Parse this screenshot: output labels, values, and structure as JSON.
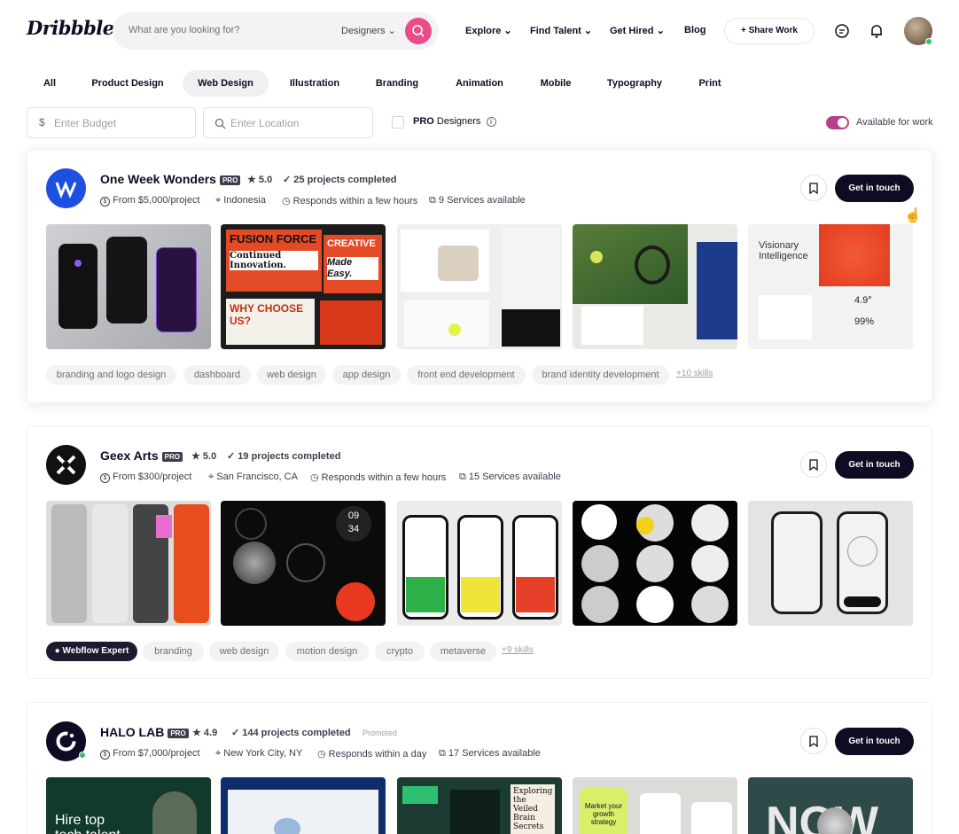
{
  "header": {
    "logo": "Dribbble",
    "search_placeholder": "What are you looking for?",
    "search_select": "Designers ⌄",
    "nav": [
      "Explore ⌄",
      "Find Talent ⌄",
      "Get Hired ⌄",
      "Blog"
    ],
    "share": "+ Share Work"
  },
  "categories": [
    "All",
    "Product Design",
    "Web Design",
    "Illustration",
    "Branding",
    "Animation",
    "Mobile",
    "Typography",
    "Print"
  ],
  "active_category": "Web Design",
  "filters": {
    "budget_placeholder": "Enter Budget",
    "location_placeholder": "Enter Location",
    "pro_label_bold": "PRO",
    "pro_label": "Designers",
    "available": "Available for work"
  },
  "colors": {
    "accent": "#ea4c89",
    "toggle": "#b53e8c",
    "dark": "#0d0c22"
  },
  "cards": [
    {
      "name": "One Week Wonders",
      "pro": "PRO",
      "rating": "★ 5.0",
      "projects": "✓ 25 projects completed",
      "price": "From $5,000/project",
      "location": "Indonesia",
      "responds": "Responds within a few hours",
      "services": "9 Services available",
      "cta": "Get in touch",
      "tags": [
        "branding and logo design",
        "dashboard",
        "web design",
        "app design",
        "front end development",
        "brand identity development"
      ],
      "more": "+10 skills"
    },
    {
      "name": "Geex Arts",
      "pro": "PRO",
      "rating": "★ 5.0",
      "projects": "✓ 19 projects completed",
      "price": "From $300/project",
      "location": "San Francisco, CA",
      "responds": "Responds within a few hours",
      "services": "15 Services available",
      "cta": "Get in touch",
      "badge": "Webflow Expert",
      "tags": [
        "branding",
        "web design",
        "motion design",
        "crypto",
        "metaverse"
      ],
      "more": "+9 skills"
    },
    {
      "name": "HALO LAB",
      "pro": "PRO",
      "rating": "★ 4.9",
      "projects": "✓ 144 projects completed",
      "promoted": "Promoted",
      "price": "From $7,000/project",
      "location": "New York City, NY",
      "responds": "Responds within a day",
      "services": "17 Services available",
      "cta": "Get in touch"
    }
  ],
  "thumb_text": {
    "c1t2a": "FUSION FORCE",
    "c1t2b": "Continued Innovation.",
    "c1t2c": "CREATIVE",
    "c1t2d": "Made Easy.",
    "c1t2e": "WHY CHOOSE US?",
    "c1t5": "Visionary Intelligence",
    "c3t1": "Hire top tech talent",
    "c3t3": "Exploring the Veiled Brain Secrets",
    "c3t4": "Market your growth strategy",
    "c3t5": "NOW",
    "c2t2a": "09",
    "c2t2b": "34"
  }
}
